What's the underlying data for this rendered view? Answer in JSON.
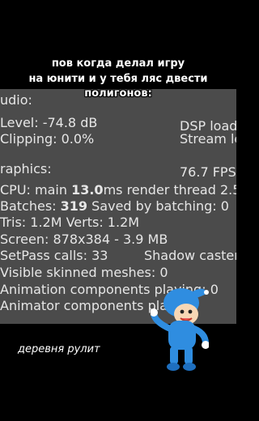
{
  "caption": {
    "line1": "пов когда делал игру",
    "line2": "на юнити и у тебя ляс двести",
    "line3": "полигонов:"
  },
  "stats": {
    "audio_header": "udio:",
    "level": "Level: -74.8 dB",
    "dsp": "DSP load",
    "clipping": "Clipping: 0.0%",
    "stream": "Stream le",
    "graphics_header": "raphics:",
    "fps": "76.7 FPS",
    "cpu_prefix": "CPU: main ",
    "cpu_value": "13.0",
    "cpu_suffix": "ms  render thread 2.5",
    "batches_prefix": "Batches: ",
    "batches_value": "319",
    "batches_suffix": "   Saved by batching: 0",
    "tris": "Tris: 1.2M  Verts: 1.2M",
    "screen": "Screen: 878x384 - 3.9 MB",
    "setpass": "SetPass calls: 33",
    "shadow": "Shadow caster",
    "skinned": "Visible skinned meshes: 0",
    "anim": "Animation components playing: 0",
    "animator": "Animator components playing"
  },
  "subcaption": "деревня рулит",
  "character_icon": "pocoyo-character-icon",
  "colors": {
    "panel": "#4b4b4b",
    "stat_text": "#e6e6e6",
    "character_blue": "#2f8de0"
  }
}
